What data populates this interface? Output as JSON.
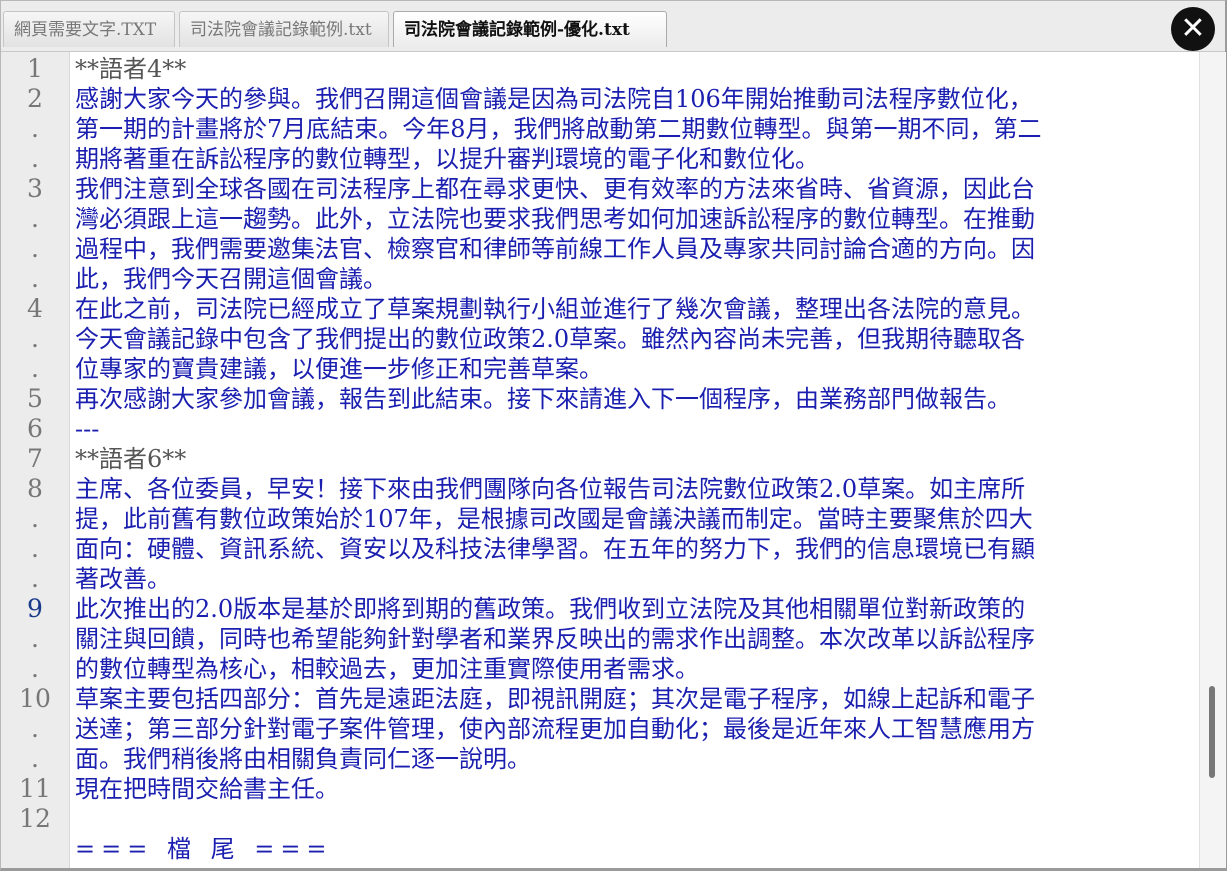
{
  "tabs": [
    {
      "label": "網頁需要文字.TXT"
    },
    {
      "label": "司法院會議記錄範例.txt"
    },
    {
      "label": "司法院會議記錄範例-優化.txt"
    }
  ],
  "close_label": "✕",
  "gutter": [
    "1",
    "2",
    ".",
    ".",
    "3",
    ".",
    ".",
    ".",
    "4",
    ".",
    ".",
    "5",
    "6",
    "7",
    "8",
    ".",
    ".",
    ".",
    "9",
    ".",
    ".",
    "10",
    ".",
    ".",
    "11",
    "12"
  ],
  "lines": [
    "**語者4**",
    "感謝大家今天的參與。我們召開這個會議是因為司法院自106年開始推動司法程序數位化，",
    "第一期的計畫將於7月底結束。今年8月，我們將啟動第二期數位轉型。與第一期不同，第二",
    "期將著重在訴訟程序的數位轉型，以提升審判環境的電子化和數位化。",
    "我們注意到全球各國在司法程序上都在尋求更快、更有效率的方法來省時、省資源，因此台",
    "灣必須跟上這一趨勢。此外，立法院也要求我們思考如何加速訴訟程序的數位轉型。在推動",
    "過程中，我們需要邀集法官、檢察官和律師等前線工作人員及專家共同討論合適的方向。因",
    "此，我們今天召開這個會議。",
    "在此之前，司法院已經成立了草案規劃執行小組並進行了幾次會議，整理出各法院的意見。",
    "今天會議記錄中包含了我們提出的數位政策2.0草案。雖然內容尚未完善，但我期待聽取各",
    "位專家的寶貴建議，以便進一步修正和完善草案。",
    "再次感謝大家參加會議，報告到此結束。接下來請進入下一個程序，由業務部門做報告。",
    "---",
    "**語者6**",
    "主席、各位委員，早安！接下來由我們團隊向各位報告司法院數位政策2.0草案。如主席所",
    "提，此前舊有數位政策始於107年，是根據司改國是會議決議而制定。當時主要聚焦於四大",
    "面向：硬體、資訊系統、資安以及科技法律學習。在五年的努力下，我們的信息環境已有顯",
    "著改善。",
    "此次推出的2.0版本是基於即將到期的舊政策。我們收到立法院及其他相關單位對新政策的",
    "關注與回饋，同時也希望能夠針對學者和業界反映出的需求作出調整。本次改革以訴訟程序",
    "的數位轉型為核心，相較過去，更加注重實際使用者需求。",
    "草案主要包括四部分：首先是遠距法庭，即視訊開庭；其次是電子程序，如線上起訴和電子",
    "送達；第三部分針對電子案件管理，使內部流程更加自動化；最後是近年來人工智慧應用方",
    "面。我們稍後將由相關負責同仁逐一說明。",
    "現在把時間交給書主任。",
    "",
    "===  檔 尾  ==="
  ]
}
